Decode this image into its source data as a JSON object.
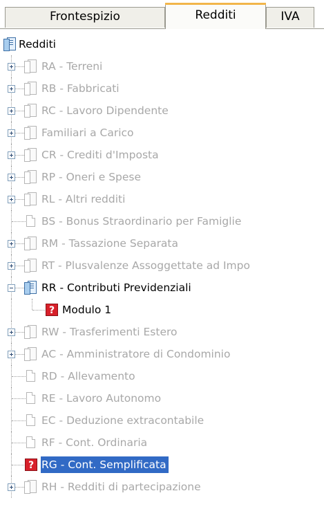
{
  "tabs": [
    {
      "label": "Frontespizio",
      "active": false
    },
    {
      "label": "Redditi",
      "active": true
    },
    {
      "label": "IVA",
      "active": false
    }
  ],
  "tree": {
    "root": "Redditi",
    "items": [
      {
        "label": "RA - Terreni"
      },
      {
        "label": "RB - Fabbricati"
      },
      {
        "label": "RC - Lavoro Dipendente"
      },
      {
        "label": "Familiari a Carico"
      },
      {
        "label": "CR - Crediti d'Imposta"
      },
      {
        "label": "RP - Oneri e Spese"
      },
      {
        "label": "RL - Altri redditi"
      },
      {
        "label": "BS - Bonus Straordinario per Famiglie"
      },
      {
        "label": "RM - Tassazione Separata"
      },
      {
        "label": "RT - Plusvalenze Assoggettate ad Impo"
      },
      {
        "label": "RR - Contributi Previdenziali",
        "expanded": true
      },
      {
        "label": "Modulo 1"
      },
      {
        "label": "RW - Trasferimenti Estero"
      },
      {
        "label": "AC - Amministratore di Condominio"
      },
      {
        "label": "RD - Allevamento"
      },
      {
        "label": "RE - Lavoro Autonomo"
      },
      {
        "label": "EC - Deduzione extracontabile"
      },
      {
        "label": "RF - Cont. Ordinaria"
      },
      {
        "label": "RG - Cont. Semplificata",
        "selected": true
      },
      {
        "label": "RH - Redditi di partecipazione"
      }
    ]
  },
  "colors": {
    "selection": "#316ac5",
    "disabled_text": "#a8a8a8",
    "active_tab_accent": "#f2b54a",
    "help_icon": "#d8202a"
  },
  "icons": {
    "help": "?"
  }
}
